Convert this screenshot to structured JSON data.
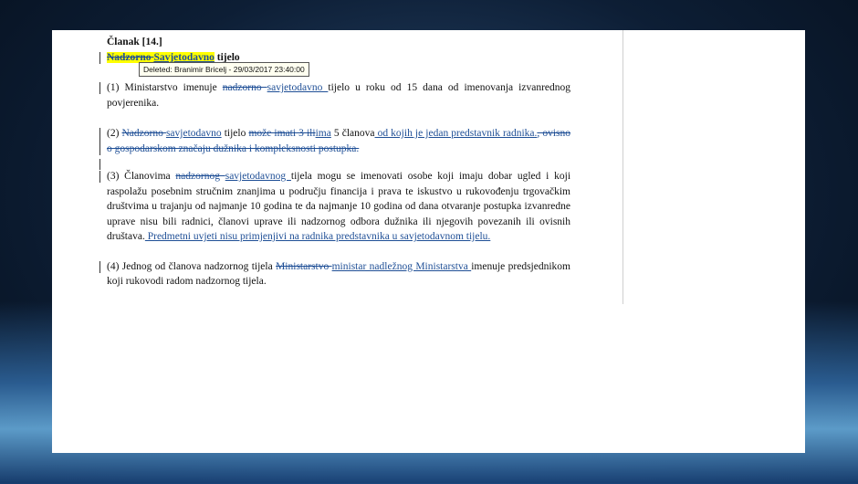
{
  "article": {
    "heading": "Članak [14.]",
    "title_deleted": "Nadzorno ",
    "title_inserted": "Savjetodavno",
    "title_rest": " tijelo"
  },
  "tooltip": "Deleted: Branimir Bricelj - 29/03/2017 23:40:00",
  "p1": {
    "t1": "(1) Ministarstvo imenuje ",
    "del1": "nadzorno ",
    "ins1": "savjetodavno ",
    "t2": "tijelo u roku od 15 dana od imenovanja izvanrednog povjerenika."
  },
  "p2": {
    "t1": "(2) ",
    "del1": "Nadzorno ",
    "ins1": "savjetodavno",
    "t2": " tijelo ",
    "del2": "može imati 3 ili",
    "ins2": "ima",
    "t3": "  5 članova",
    "ins3": " od kojih je jedan predstavnik radnika.",
    "del3": ", ovisno o gospodarskom značaju dužnika i kompleksnosti postupka."
  },
  "p3": {
    "t1": "(3) Članovima ",
    "del1": "nadzornog ",
    "ins1": "savjetodavnog ",
    "t2": "tijela mogu se imenovati osobe koji imaju dobar ugled i koji raspolažu posebnim stručnim znanjima u području financija i prava te iskustvo u rukovođenju trgovačkim društvima u trajanju od najmanje 10 godina te da najmanje 10 godina od dana otvaranje postupka izvanredne uprave nisu bili radnici, članovi uprave ili nadzornog odbora dužnika ili njegovih povezanih ili ovisnih društava.",
    "ins2": " Predmetni uvjeti nisu primjenjivi na radnika predstavnika u savjetodavnom tijelu."
  },
  "p4": {
    "t1": "(4) Jednog od članova nadzornog tijela ",
    "del1": "Ministarstvo ",
    "ins1": "ministar nadležnog Ministarstva ",
    "t2": "imenuje predsjednikom koji rukovodi radom nadzornog tijela."
  }
}
